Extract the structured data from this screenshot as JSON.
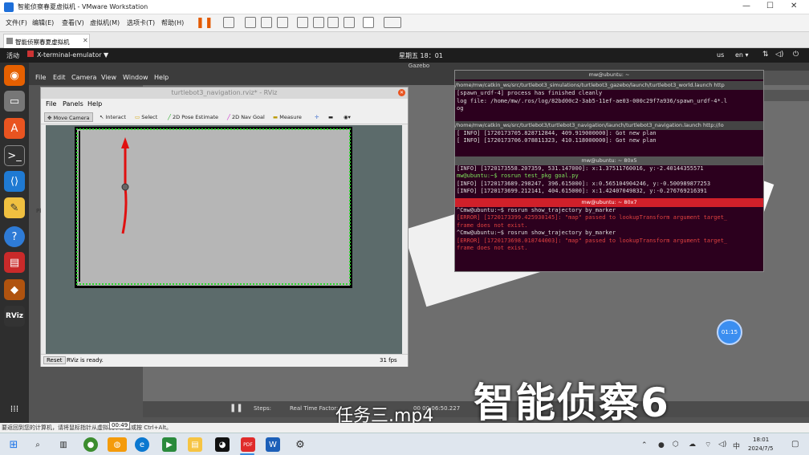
{
  "vmware": {
    "title": "智能侦察春夏虚拟机 - VMware Workstation",
    "menu": [
      "文件(F)",
      "编辑(E)",
      "查看(V)",
      "虚拟机(M)",
      "选项卡(T)",
      "帮助(H)"
    ],
    "tab_label": "智能侦察春夏虚拟机",
    "status_text": "要返回到您的计算机，请将鼠标指针从虚拟机中移出或按 Ctrl+Alt。",
    "tooltip_time": "00:49"
  },
  "gnome": {
    "activities": "活动",
    "app_name": "X-terminal-emulator ▼",
    "clock": "星期五 18：01",
    "tray_us": "us",
    "tray_en": "en ▾"
  },
  "xterm_menu": [
    "File",
    "Edit",
    "Camera",
    "View",
    "Window",
    "Help"
  ],
  "gazebo_title": "Gazebo",
  "rviz": {
    "title": "turtlebot3_navigation.rviz* - RViz",
    "menu": [
      "File",
      "Panels",
      "Help"
    ],
    "tools": [
      "Move Camera",
      "Interact",
      "Select",
      "2D Pose Estimate",
      "2D Nav Goal",
      "Measure"
    ],
    "reset_label": "Reset",
    "status": "RViz is ready.",
    "fps": "31 fps",
    "side_label": "Pl"
  },
  "terminals": {
    "t0_title": "mw@ubuntu: ~",
    "t1_header": "/home/mw/catkin_ws/src/turtlebot3_simulations/turtlebot3_gazebo/launch/turtlebot3_world.launch http",
    "t1_lines": [
      "[spawn_urdf-4] process has finished cleanly",
      "log file: /home/mw/.ros/log/82bd00c2-3ab5-11ef-ae03-000c29f7a936/spawn_urdf-4*.l",
      "og"
    ],
    "t2_header": "/home/mw/catkin_ws/src/turtlebot3/turtlebot3_navigation/launch/turtlebot3_navigation.launch http://lo",
    "t2_lines": [
      "[ INFO] [1720173705.828712844, 409.919000000]: Got new plan",
      "[ INFO] [1720173706.078811323, 410.118000000]: Got new plan"
    ],
    "t3_title": "mw@ubuntu: ~ 80x5",
    "t3_lines": [
      "[INFO] [1720173558.207359, 531.147000]: x:1.37511760016, y:-2.40144355571",
      "mw@ubuntu:~$ rosrun test_pkg goal.py",
      "[INFO] [1720173689.298247, 396.615000]: x:0.565104904246, y:-0.500989877253",
      "[INFO] [1720173699.212141, 404.615000]: x:1.42407049832, y:-0.276769216391"
    ],
    "t4_title": "mw@ubuntu: ~ 80x7",
    "t4_lines": [
      "^Cmw@ubuntu:~$ rosrun show_trajectory by_marker",
      "[ERROR] [1720173399.425930145]: \"map\" passed to lookupTransform argument target_",
      "frame does not exist.",
      "^Cmw@ubuntu:~$ rosrun show_trajectory by_marker",
      "[ERROR] [1720173698.018744003]: \"map\" passed to lookupTransform argument target_",
      "frame does not exist."
    ]
  },
  "gazebo_bottom": {
    "steps": "Steps:",
    "rtf": "Real Time Factor:",
    "time": "00 00:06:50.227",
    "iter": "Itera"
  },
  "timer_label": "01:15",
  "overlay_text": "智能侦察6",
  "subtitle": "任务三.mp4",
  "taskbar": {
    "time": "18:01",
    "date": "2024/7/5",
    "ime": "中"
  },
  "colors": {
    "terminal_bg": "#2c001e",
    "error": "#e04040",
    "green_prompt": "#7ee25c",
    "map_wall": "#000000",
    "path": "#e01010"
  }
}
